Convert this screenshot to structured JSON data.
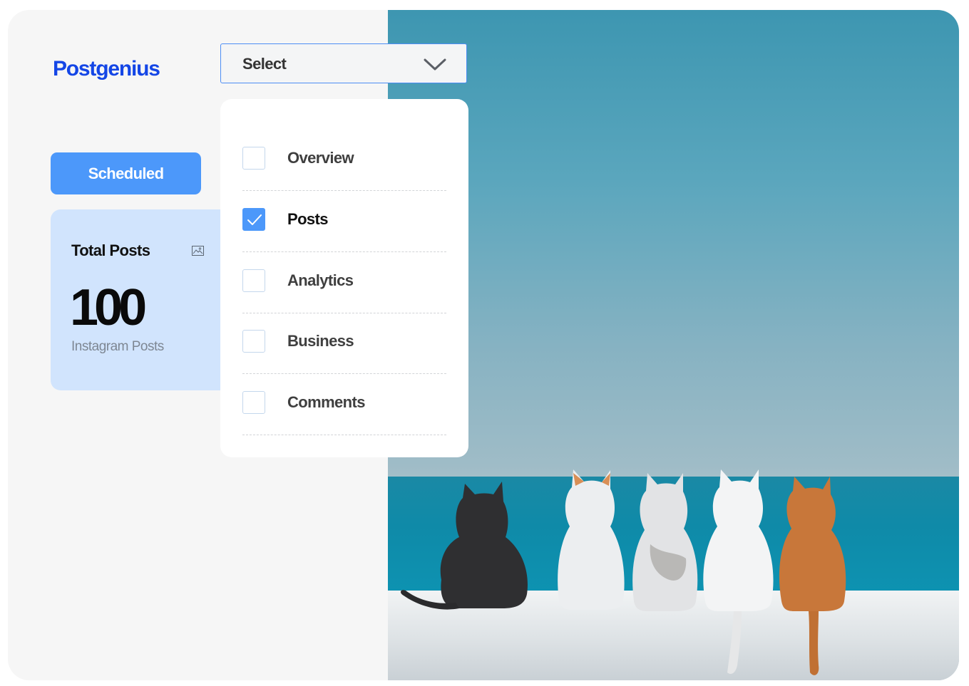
{
  "brand": {
    "name": "Postgenius",
    "color": "#1446e6"
  },
  "sidebar": {
    "scheduled_label": "Scheduled"
  },
  "stats": {
    "title": "Total Posts",
    "icon": "image-icon",
    "value": "100",
    "subtitle": "Instagram Posts"
  },
  "select": {
    "label": "Select",
    "icon": "chevron-down-icon"
  },
  "dropdown": {
    "options": [
      {
        "label": "Overview",
        "checked": false
      },
      {
        "label": "Posts",
        "checked": true
      },
      {
        "label": "Analytics",
        "checked": false
      },
      {
        "label": "Business",
        "checked": false
      },
      {
        "label": "Comments",
        "checked": false
      }
    ]
  },
  "photo": {
    "subject": "five cats on a white wall facing the sea"
  },
  "colors": {
    "accent": "#4c98fa",
    "card_bg": "#d1e4fd",
    "select_border": "#4c8df4"
  }
}
